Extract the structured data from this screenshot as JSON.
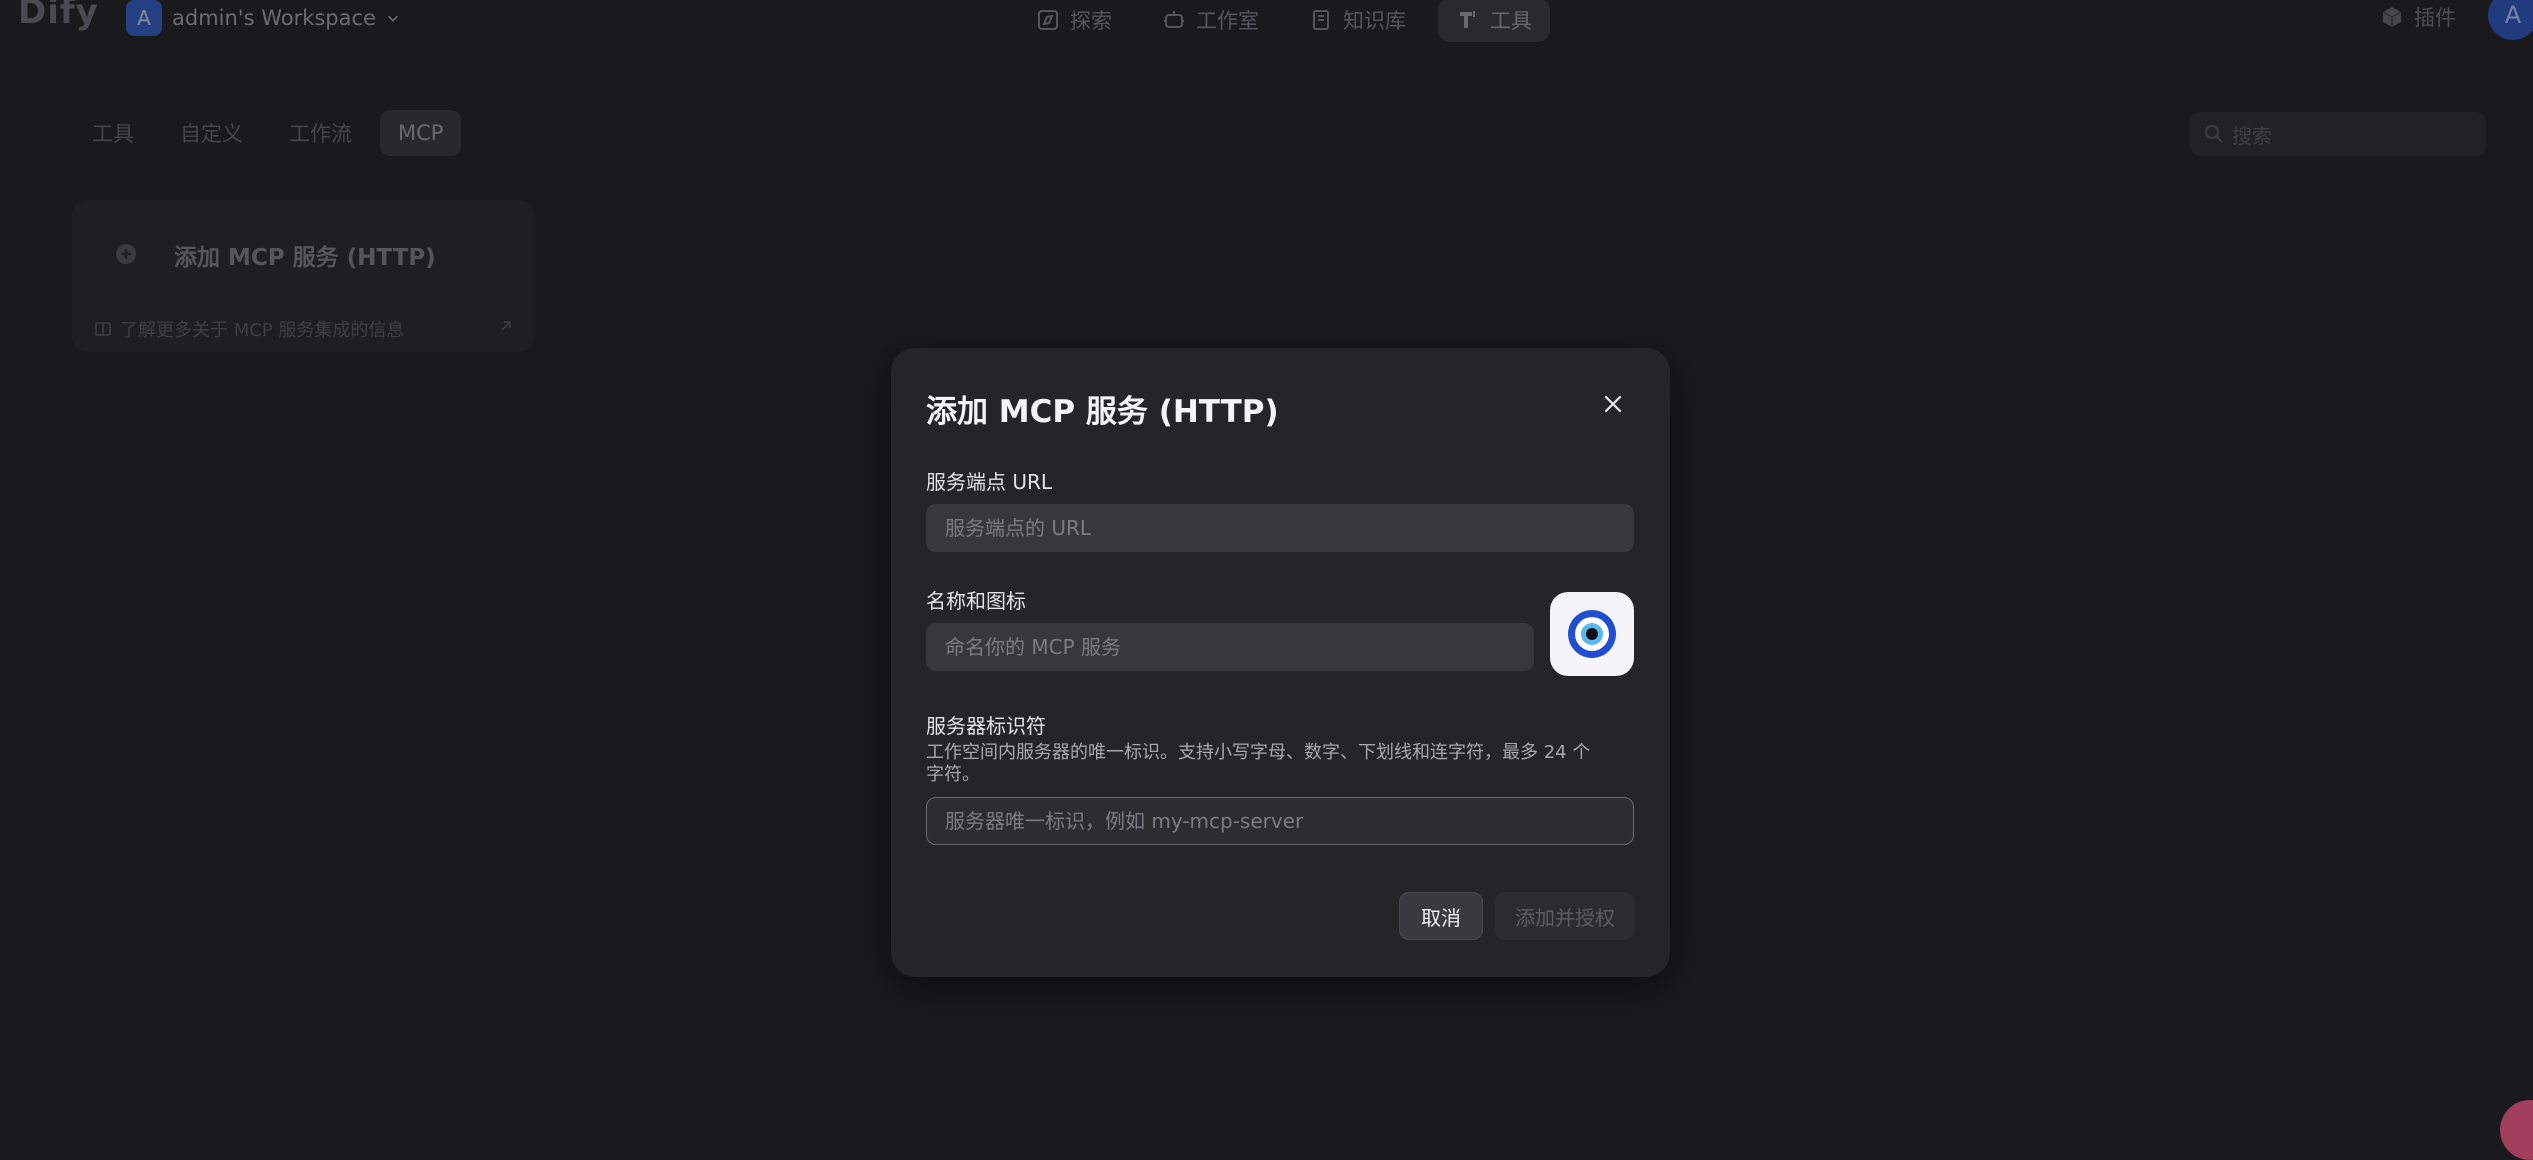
{
  "app": {
    "logo": "Dify"
  },
  "workspace": {
    "avatar": "A",
    "name": "admin's Workspace"
  },
  "nav": {
    "items": [
      {
        "label": "探索",
        "icon": "explore-icon"
      },
      {
        "label": "工作室",
        "icon": "studio-icon"
      },
      {
        "label": "知识库",
        "icon": "knowledge-icon"
      },
      {
        "label": "工具",
        "icon": "tools-icon",
        "active": true
      }
    ]
  },
  "header": {
    "plugins_label": "插件",
    "user_avatar": "A"
  },
  "subtabs": [
    {
      "label": "工具"
    },
    {
      "label": "自定义"
    },
    {
      "label": "工作流"
    },
    {
      "label": "MCP",
      "active": true
    }
  ],
  "search": {
    "placeholder": "搜索"
  },
  "mcp_card": {
    "title": "添加 MCP 服务 (HTTP)",
    "learn_more": "了解更多关于 MCP 服务集成的信息"
  },
  "modal": {
    "title": "添加 MCP 服务 (HTTP)",
    "url_label": "服务端点 URL",
    "url_placeholder": "服务端点的 URL",
    "name_label": "名称和图标",
    "name_placeholder": "命名你的 MCP 服务",
    "server_id_label": "服务器标识符",
    "server_id_desc": "工作空间内服务器的唯一标识。支持小写字母、数字、下划线和连字符，最多 24 个字符。",
    "server_id_placeholder": "服务器唯一标识，例如 my-mcp-server",
    "cancel_label": "取消",
    "submit_label": "添加并授权",
    "icon": "eye-amulet-icon"
  }
}
